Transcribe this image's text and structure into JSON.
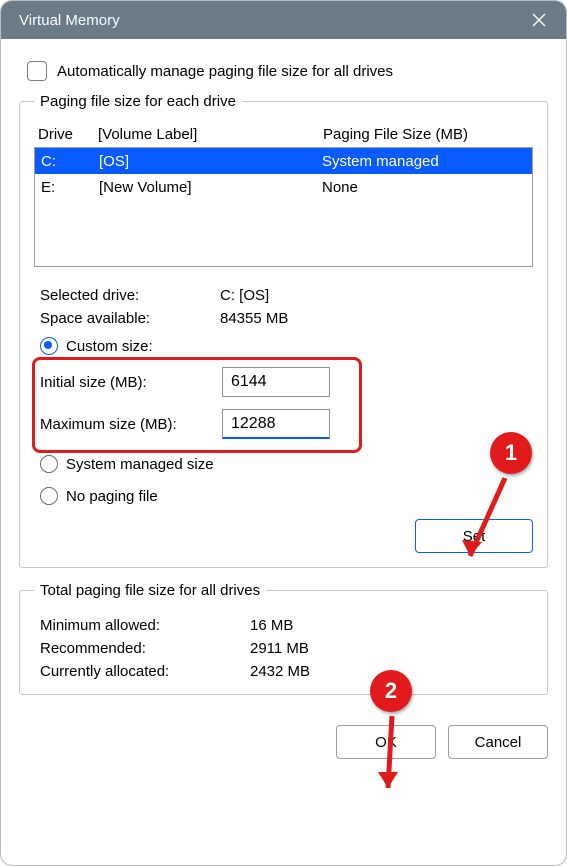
{
  "window": {
    "title": "Virtual Memory"
  },
  "auto": {
    "label": "Automatically manage paging file size for all drives",
    "checked": false
  },
  "group1": {
    "legend": "Paging file size for each drive",
    "headers": {
      "drive": "Drive",
      "volume": "[Volume Label]",
      "size": "Paging File Size (MB)"
    },
    "rows": [
      {
        "drive": "C:",
        "volume": "[OS]",
        "size": "System managed",
        "selected": true
      },
      {
        "drive": "E:",
        "volume": "[New Volume]",
        "size": "None",
        "selected": false
      }
    ],
    "selected_drive_label": "Selected drive:",
    "selected_drive_value": "C:  [OS]",
    "space_label": "Space available:",
    "space_value": "84355 MB",
    "radios": {
      "custom": "Custom size:",
      "system": "System managed size",
      "none": "No paging file",
      "checked": "custom"
    },
    "initial_label": "Initial size (MB):",
    "initial_value": "6144",
    "maximum_label": "Maximum size (MB):",
    "maximum_value": "12288",
    "set_button": "Set"
  },
  "group2": {
    "legend": "Total paging file size for all drives",
    "min_label": "Minimum allowed:",
    "min_value": "16 MB",
    "rec_label": "Recommended:",
    "rec_value": "2911 MB",
    "cur_label": "Currently allocated:",
    "cur_value": "2432 MB"
  },
  "footer": {
    "ok": "OK",
    "cancel": "Cancel"
  },
  "annotations": {
    "badge1": "1",
    "badge2": "2"
  }
}
